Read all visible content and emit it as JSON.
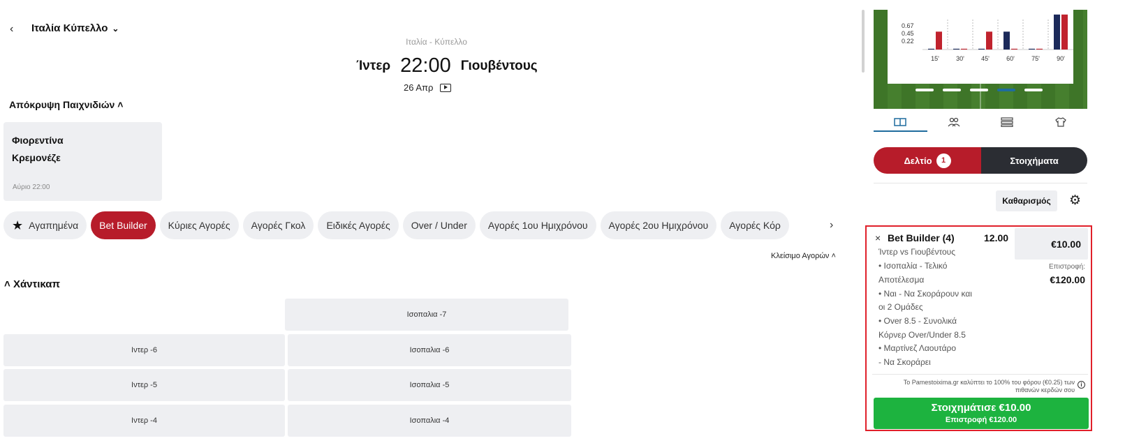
{
  "header": {
    "back_icon": "‹",
    "competition": "Ιταλία Κύπελλο",
    "league_sub": "Ιταλία - Κύπελλο",
    "home_team": "Ίντερ",
    "kickoff": "22:00",
    "away_team": "Γιουβέντους",
    "date": "26 Απρ"
  },
  "games": {
    "toggle_label": "Απόκρυψη Παιχνιδιών",
    "card": {
      "home": "Φιορεντίνα",
      "away": "Κρεμονέζε",
      "when": "Αύριο 22:00"
    }
  },
  "tabs": [
    {
      "label": "Αγαπημένα"
    },
    {
      "label": "Bet Builder"
    },
    {
      "label": "Κύριες Αγορές"
    },
    {
      "label": "Αγορές Γκολ"
    },
    {
      "label": "Ειδικές Αγορές"
    },
    {
      "label": "Over / Under"
    },
    {
      "label": "Αγορές 1ου Ημιχρόνου"
    },
    {
      "label": "Αγορές 2ου Ημιχρόνου"
    },
    {
      "label": "Αγορές Κόρ"
    }
  ],
  "markets": {
    "close_label": "Κλείσιμο Αγορών",
    "section_title": "Χάντικαπ",
    "rows": [
      {
        "left": "",
        "right": "Ισοπαλια -7"
      },
      {
        "left": "Ιντερ -6",
        "right": "Ισοπαλια -6"
      },
      {
        "left": "Ιντερ -5",
        "right": "Ισοπαλια -5"
      },
      {
        "left": "Ιντερ -4",
        "right": "Ισοπαλια -4"
      }
    ]
  },
  "chart_data": {
    "type": "bar",
    "categories": [
      "15'",
      "30'",
      "45'",
      "60'",
      "75'",
      "90'"
    ],
    "yticks": [
      "0.67",
      "0.45",
      "0.22"
    ],
    "series": [
      {
        "color": "#1c2a5a",
        "values": [
          0.02,
          0.02,
          0.02,
          0.45,
          0.02,
          0.88
        ]
      },
      {
        "color": "#c0232e",
        "values": [
          0.45,
          0.02,
          0.45,
          0.02,
          0.02,
          0.88
        ]
      }
    ],
    "ylim": [
      0,
      1
    ]
  },
  "panel": {
    "slip_label": "Δελτίο",
    "slip_count": "1",
    "bets_label": "Στοιχήματα",
    "clear_label": "Καθαρισμός"
  },
  "bet": {
    "title": "Bet Builder (4)",
    "odds": "12.00",
    "stake": "€10.00",
    "return_label": "Επιστροφή:",
    "return_value": "€120.00",
    "match": "Ίντερ vs Γιουβέντους",
    "lines": [
      "• Ισοπαλία  - Τελικό",
      "Αποτέλεσμα",
      "• Ναι  - Να Σκοράρουν και",
      "οι 2 Ομάδες",
      "• Over 8.5 - Συνολικά",
      "Κόρνερ Over/Under 8.5",
      "• Μαρτίνεζ Λαουτάρο",
      " - Να Σκοράρει"
    ],
    "tax_text": "Το Pamestoixima.gr καλύπτει το 100% του φόρου (€0.25) των πιθανών κερδών σου",
    "place_label": "Στοιχημάτισε €10.00",
    "place_sub": "Επιστροφή  €120.00"
  },
  "colors": {
    "brand_red": "#b71c2a",
    "green": "#1db33f",
    "highlight": "#e0202a"
  }
}
